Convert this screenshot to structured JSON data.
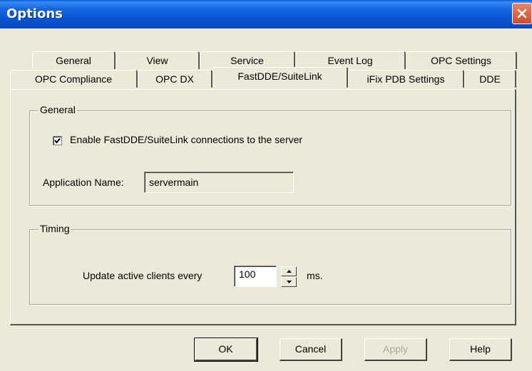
{
  "window": {
    "title": "Options"
  },
  "tabs": {
    "back_row": [
      "General",
      "View",
      "Service",
      "Event Log",
      "OPC Settings"
    ],
    "front_row": [
      "OPC Compliance",
      "OPC DX",
      "FastDDE/SuiteLink",
      "iFix PDB Settings",
      "DDE"
    ],
    "active": "FastDDE/SuiteLink"
  },
  "general": {
    "group_label": "General",
    "enable_label": "Enable FastDDE/SuiteLink connections to the server",
    "enable_checked": true,
    "app_name_label": "Application Name:",
    "app_name_value": "servermain"
  },
  "timing": {
    "group_label": "Timing",
    "update_label": "Update active clients every",
    "update_value": "100",
    "unit": "ms."
  },
  "buttons": {
    "ok": "OK",
    "cancel": "Cancel",
    "apply": "Apply",
    "help": "Help"
  }
}
